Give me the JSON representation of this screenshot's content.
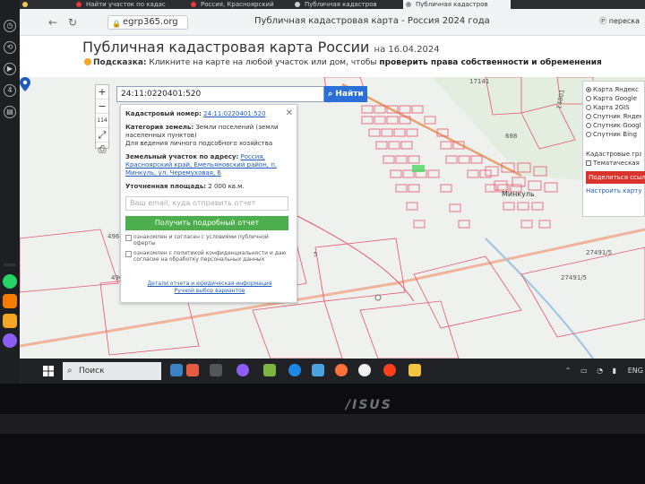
{
  "browser": {
    "tabs": [
      {
        "label": "",
        "color": "#f2c94c"
      },
      {
        "label": "Найти участок по кадас",
        "color": "#e53935"
      },
      {
        "label": "Россия, Красноярский",
        "color": "#e53935"
      },
      {
        "label": "Публичная кадастров",
        "color": "#cccccc"
      },
      {
        "label": "Публичная кадастров",
        "color": "#cccccc"
      }
    ],
    "url": "egrp365.org",
    "window_title": "Публичная кадастровая карта - Россия 2024 года",
    "right_text": "Ⓟ переска"
  },
  "header": {
    "title": "Публичная кадастровая карта России",
    "date_prefix": "на",
    "date": "16.04.2024",
    "hint_label": "Подсказка:",
    "hint_text": "Кликните на карте на любой участок или дом, чтобы",
    "hint_link": "проверить права собственности и обременения"
  },
  "map": {
    "zoom_in": "+",
    "zoom_out": "−",
    "scale_text": "114",
    "search_value": "24:11:0220401:520",
    "search_button": "Найти",
    "labels": {
      "l17141": "17141",
      "l688": "688",
      "l14801": "14801",
      "l496a": "496",
      "l496b": "496",
      "l27491": "27491/5",
      "l274915": "27491/5",
      "l5": "5",
      "village": "Минкуль"
    },
    "popup": {
      "cadastral_label": "Кадастровый номер:",
      "cadastral_value": "24:11:0220401:520",
      "category_label": "Категория земель:",
      "category_value": "Земли поселений (земли населенных пунктов)",
      "usage_value": "Для ведения личного подсобного хозяйства",
      "address_label": "Земельный участок по адресу:",
      "address_value": "Россия, Красноярский край, Емельяновский район, п. Минкуль, ул. Черемуховая, 6",
      "area_label": "Уточненная площадь:",
      "area_value": "2 000 кв.м.",
      "email_placeholder": "Ваш email, куда отправить отчет",
      "report_button": "Получить подробный отчет",
      "agree1": "ознакомлен и согласен с условиями публичной оферты",
      "agree2": "ознакомлен с политикой конфиденциальности и даю согласие на обработку персональных данных",
      "foot1": "Детали отчета и юридическая информация",
      "foot2": "Ручной выбор вариантов"
    },
    "layers": {
      "options": [
        "Карта Яндекс",
        "Карта Google",
        "Карта 2GIS",
        "Спутник Яндекс",
        "Спутник Google",
        "Спутник Bing"
      ],
      "selected": "Карта Яндекс",
      "cadastral_borders": "Кадастровые границы",
      "thematic": "Тематическая карта",
      "share": "Поделиться ссылкой",
      "settings": "Настроить карту"
    }
  },
  "taskbar": {
    "search_placeholder": "Поиск",
    "lang": "ENG",
    "tray": "⌃ ▭ ◔ ▮"
  },
  "laptop": {
    "brand": "/ISUS"
  },
  "colors": {
    "accent": "#2b6fd8",
    "report_green": "#4cae4c",
    "share_red": "#d9342b",
    "parcel_red": "#e8536b",
    "road_orange": "#e8a070"
  }
}
